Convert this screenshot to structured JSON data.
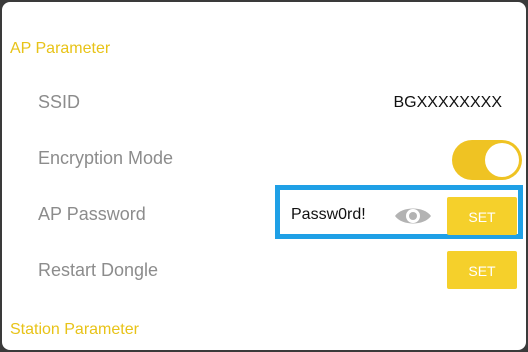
{
  "ap_section": {
    "title": "AP Parameter",
    "ssid_label": "SSID",
    "ssid_value": "BGXXXXXXXX",
    "encryption_label": "Encryption Mode",
    "encryption_enabled": true,
    "password_label": "AP Password",
    "password_value": "Passw0rd!",
    "password_set_label": "SET",
    "restart_label": "Restart Dongle",
    "restart_set_label": "SET"
  },
  "station_section": {
    "title": "Station Parameter"
  },
  "icons": {
    "password_visibility": "eye-icon"
  },
  "colors": {
    "accent": "#f5d02b",
    "section_title": "#e8c318",
    "highlight": "#1fa0e6",
    "label": "#8c8c8c"
  }
}
